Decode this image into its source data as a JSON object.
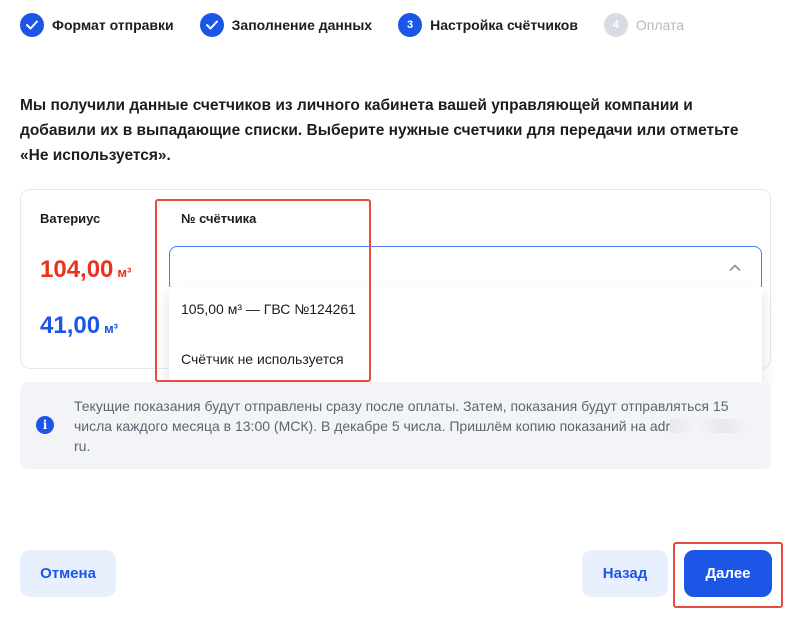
{
  "stepper": {
    "steps": [
      {
        "label": "Формат отправки",
        "state": "done"
      },
      {
        "label": "Заполнение данных",
        "state": "done"
      },
      {
        "label": "Настройка счётчиков",
        "state": "current",
        "number": "3"
      },
      {
        "label": "Оплата",
        "state": "future",
        "number": "4"
      }
    ]
  },
  "intro": "Мы получили данные счетчиков из личного кабинета вашей управляющей компании и добавили их в выпадающие списки. Выберите нужные счетчики для передачи или отметьте «Не используется».",
  "meter_card": {
    "brand_label": "Ватериус",
    "column_label": "№ счётчика",
    "readings": [
      {
        "value": "104,00",
        "unit": "м³",
        "color": "#e8321c"
      },
      {
        "value": "41,00",
        "unit": "м³",
        "color": "#1c56e6"
      }
    ],
    "select_value": "",
    "dropdown_options": [
      "105,00 м³ — ГВС №124261",
      "Счётчик не используется"
    ]
  },
  "info": {
    "text_before_mask": "Текущие показания будут отправлены сразу после оплаты. Затем, показания будут отправляться 15 числа каждого месяца в 13:00 (МСК). В декабре 5 числа. Пришлём копию показаний на adr",
    "text_after_mask": "ru."
  },
  "footer": {
    "cancel": "Отмена",
    "back": "Назад",
    "next": "Далее"
  },
  "colors": {
    "accent": "#1c56e6",
    "highlight": "#e74c3c",
    "reading_red": "#e8321c"
  }
}
